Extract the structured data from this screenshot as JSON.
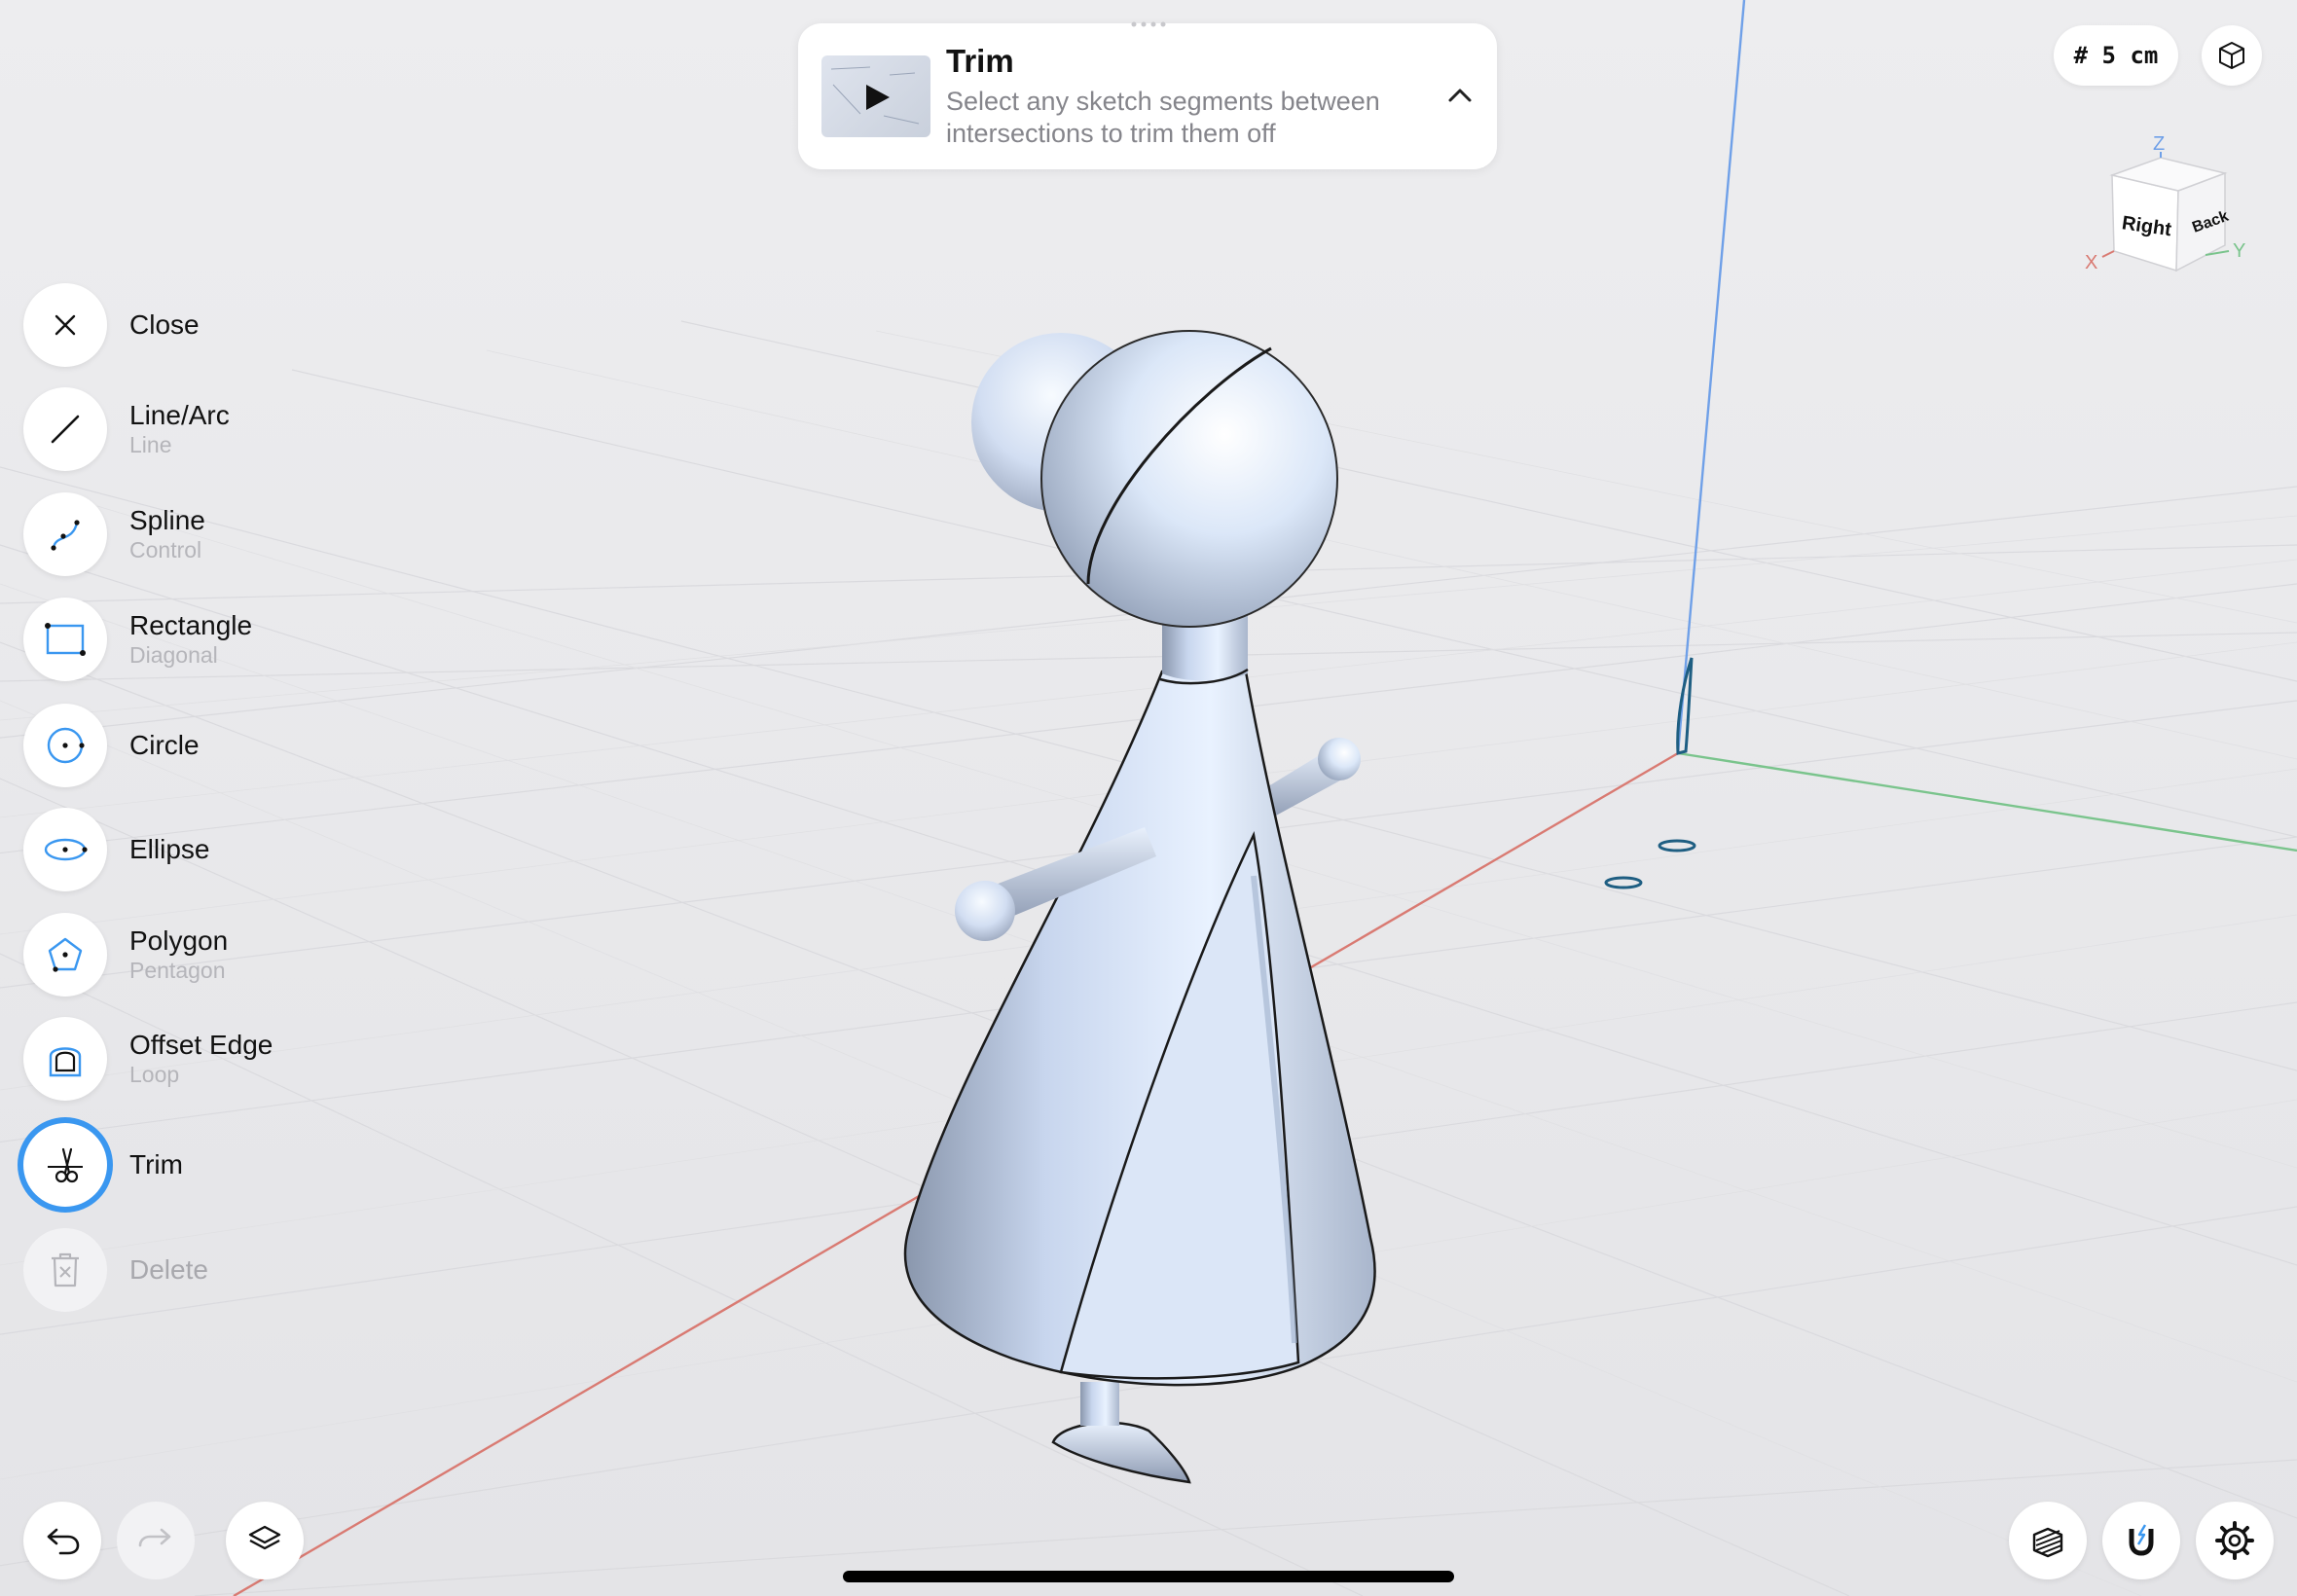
{
  "hint": {
    "title": "Trim",
    "description": "Select any sketch segments between intersections to trim them off"
  },
  "grid_label": "# 5 cm",
  "view_cube": {
    "faces": {
      "right": "Right",
      "back": "Back"
    },
    "axes": {
      "x": "X",
      "y": "Y",
      "z": "Z"
    }
  },
  "tools": [
    {
      "label": "Close",
      "sub": "",
      "icon": "close-icon"
    },
    {
      "label": "Line/Arc",
      "sub": "Line",
      "icon": "line-icon"
    },
    {
      "label": "Spline",
      "sub": "Control",
      "icon": "spline-icon"
    },
    {
      "label": "Rectangle",
      "sub": "Diagonal",
      "icon": "rectangle-icon"
    },
    {
      "label": "Circle",
      "sub": "",
      "icon": "circle-icon"
    },
    {
      "label": "Ellipse",
      "sub": "",
      "icon": "ellipse-icon"
    },
    {
      "label": "Polygon",
      "sub": "Pentagon",
      "icon": "pentagon-icon"
    },
    {
      "label": "Offset Edge",
      "sub": "Loop",
      "icon": "offset-edge-icon"
    },
    {
      "label": "Trim",
      "sub": "",
      "icon": "scissors-icon",
      "active": true
    },
    {
      "label": "Delete",
      "sub": "",
      "icon": "trash-icon",
      "disabled": true
    }
  ],
  "bottom_left": [
    "undo-icon",
    "redo-icon",
    "layers-icon"
  ],
  "bottom_right": [
    "section-view-icon",
    "snap-magnet-icon",
    "settings-gear-icon"
  ],
  "colors": {
    "accent": "#3a97f0",
    "x_axis": "#d97a72",
    "y_axis": "#7ac48c",
    "z_axis": "#6fa0e8",
    "model": "#cfe0f7"
  }
}
